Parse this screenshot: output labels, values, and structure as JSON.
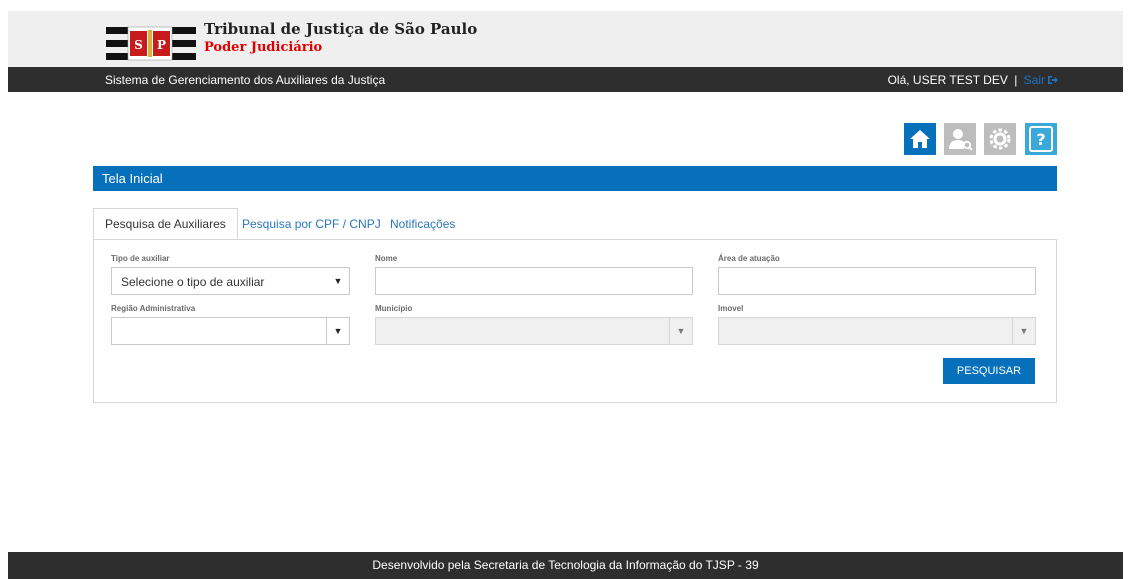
{
  "header": {
    "title": "Tribunal de Justiça de São Paulo",
    "subtitle": "Poder Judiciário",
    "logo_letters": "S P"
  },
  "navbar": {
    "system_name": "Sistema de Gerenciamento dos Auxiliares da Justiça",
    "greeting": "Olá, USER TEST DEV",
    "separator": "|",
    "logout_label": "Sair"
  },
  "toolbar_icons": [
    "home-icon",
    "user-search-icon",
    "gear-icon",
    "help-icon"
  ],
  "page_title": "Tela Inicial",
  "tabs": [
    {
      "label": "Pesquisa de Auxiliares",
      "active": true
    },
    {
      "label": "Pesquisa por CPF / CNPJ",
      "active": false
    },
    {
      "label": "Notificações",
      "active": false
    }
  ],
  "form": {
    "tipo": {
      "label": "Tipo de auxiliar",
      "value": "Selecione o tipo de auxiliar"
    },
    "nome": {
      "label": "Nome",
      "value": ""
    },
    "area": {
      "label": "Área de atuação",
      "value": ""
    },
    "regiao": {
      "label": "Região Administrativa",
      "value": ""
    },
    "municipio": {
      "label": "Município",
      "value": ""
    },
    "imovel": {
      "label": "Imovel",
      "value": ""
    },
    "caret": "▼",
    "search_label": "PESQUISAR"
  },
  "footer": {
    "text": "Desenvolvido pela Secretaria de Tecnologia da Informação do TJSP - 39"
  },
  "colors": {
    "accent": "#0671ba",
    "dark_bar": "#2e2e2e",
    "header_bg": "#efefef",
    "subtitle_red": "#e00000",
    "help_icon_bg": "#3aa8d8",
    "disabled_icon": "#bdbdbd"
  }
}
